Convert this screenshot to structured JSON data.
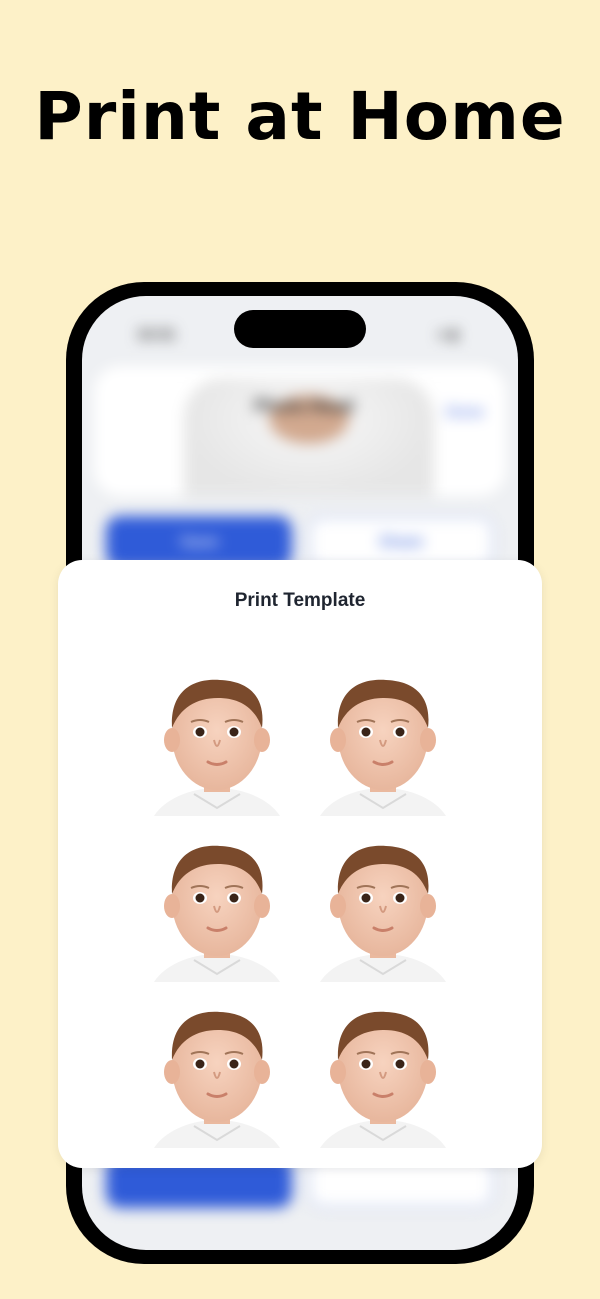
{
  "headline": "Print at Home",
  "status_bar": {
    "time": "10:31",
    "indicators": "wifi-icon battery-icon"
  },
  "background_app": {
    "photo_label": "Photo Head",
    "done_label": "Done",
    "save_label": "Save",
    "share_label": "Share"
  },
  "sheet": {
    "title": "Print Template",
    "photo_count": 6
  },
  "colors": {
    "background": "#fdf1c8",
    "accent": "#2f5bd8"
  }
}
